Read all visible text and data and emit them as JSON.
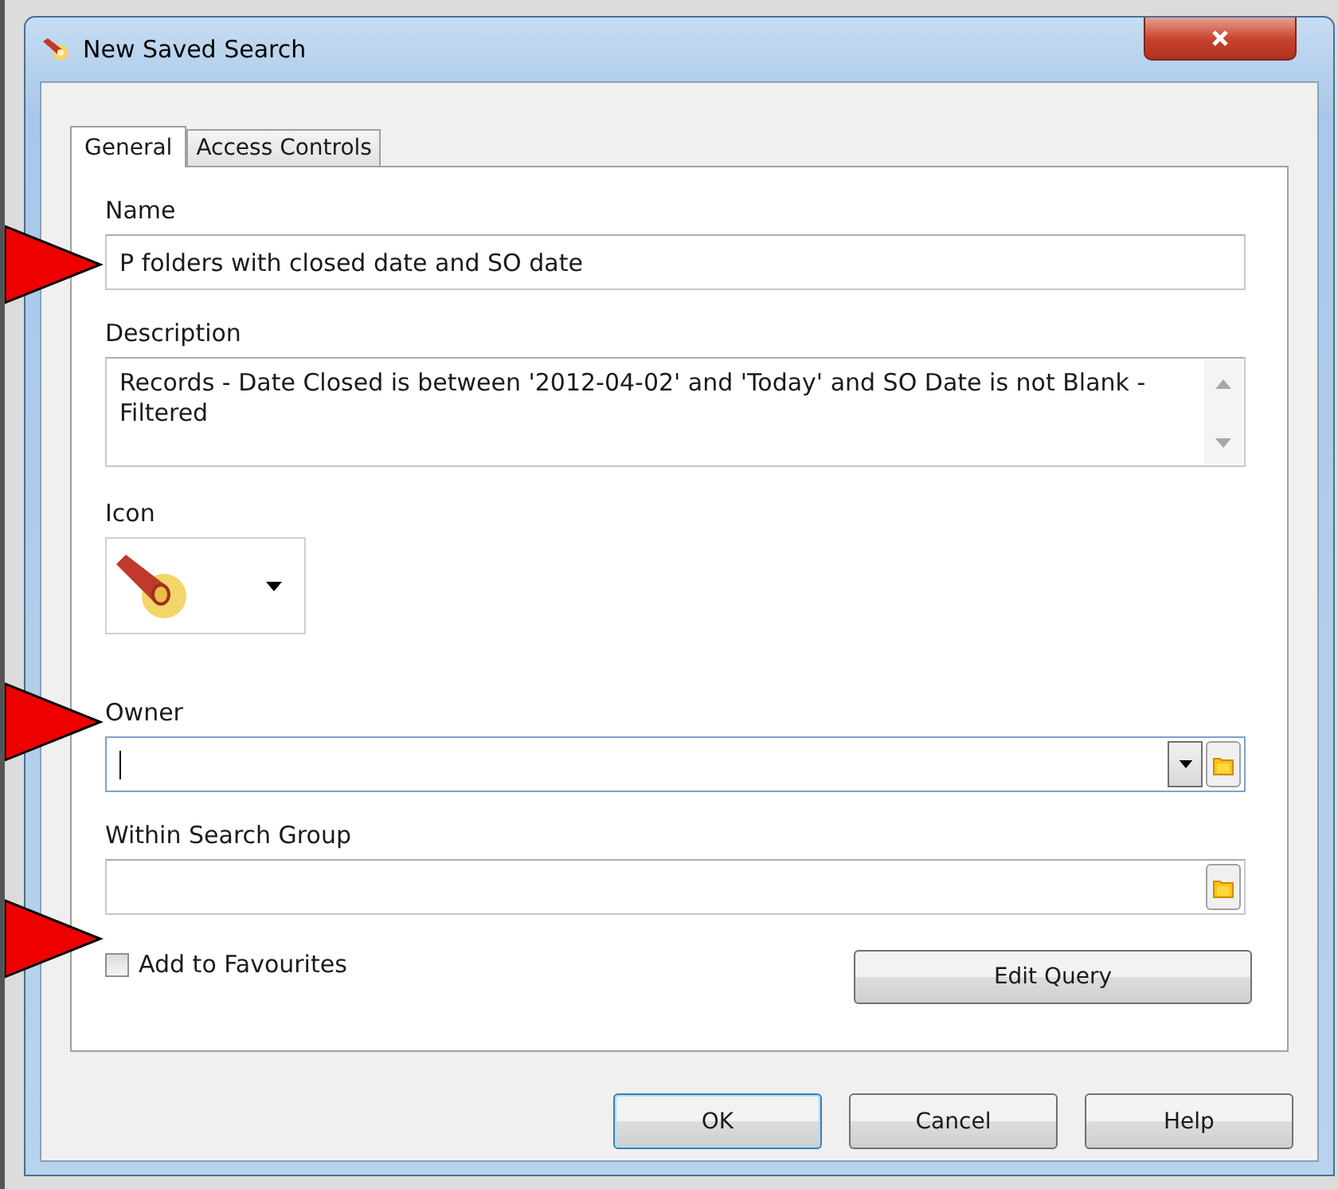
{
  "window": {
    "title": "New Saved Search"
  },
  "tabs": [
    {
      "label": "General",
      "selected": true
    },
    {
      "label": "Access Controls",
      "selected": false
    }
  ],
  "fields": [
    {
      "kind": "text",
      "label": "Name",
      "value": "P folders with closed date and SO date"
    },
    {
      "kind": "textarea",
      "label": "Description",
      "value": "Records - Date Closed is between '2012-04-02' and 'Today' and SO Date is not Blank - Filtered"
    },
    {
      "kind": "icon",
      "label": "Icon"
    },
    {
      "kind": "combo",
      "label": "Owner",
      "focused": true
    },
    {
      "kind": "picker",
      "label": "Within Search Group",
      "focused": false
    }
  ],
  "favourites": {
    "label": "Add to Favourites",
    "checked": false
  },
  "edit_query": "Edit Query",
  "buttons": [
    {
      "label": "OK",
      "default": true
    },
    {
      "label": "Cancel",
      "default": false
    },
    {
      "label": "Help",
      "default": false
    }
  ]
}
